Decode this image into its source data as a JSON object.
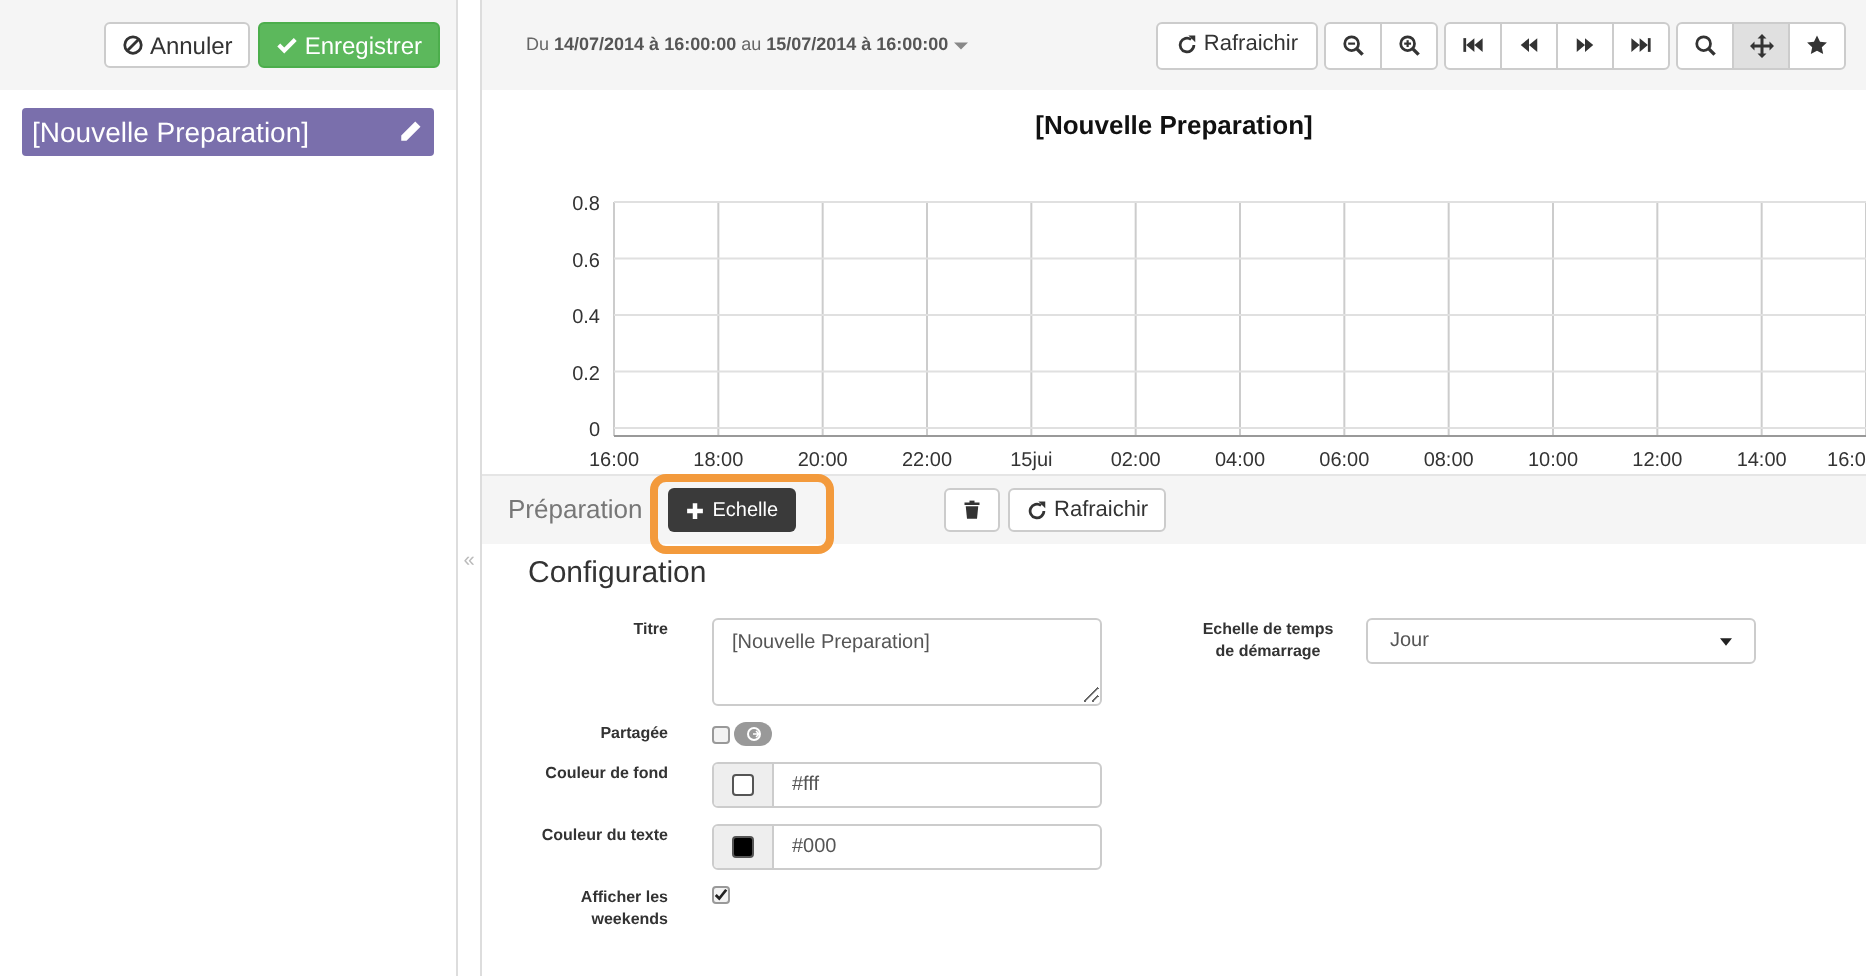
{
  "left_toolbar": {
    "buttons": [
      {
        "kind": "cancel",
        "label": "Annuler"
      },
      {
        "kind": "save",
        "label": "Enregistrer"
      }
    ]
  },
  "sidebar": {
    "items": [
      {
        "label": "[Nouvelle Preparation]",
        "selected": true
      }
    ]
  },
  "date_range": {
    "prefix": "Du",
    "start": "14/07/2014 à 16:00:00",
    "middle": "au",
    "end": "15/07/2014 à 16:00:00"
  },
  "toolbar": {
    "groups": [
      [
        {
          "kind": "refresh",
          "label": "Rafraichir",
          "active": false
        }
      ],
      [
        {
          "kind": "zoom-out",
          "active": false
        },
        {
          "kind": "zoom-in",
          "active": false
        }
      ],
      [
        {
          "kind": "first",
          "active": false
        },
        {
          "kind": "prev",
          "active": false
        },
        {
          "kind": "next",
          "active": false
        },
        {
          "kind": "last",
          "active": false
        }
      ],
      [
        {
          "kind": "search",
          "active": false
        },
        {
          "kind": "move",
          "active": true
        },
        {
          "kind": "star",
          "active": false
        }
      ]
    ]
  },
  "chart": {
    "chart_data": {
      "type": "line",
      "title": "[Nouvelle Preparation]",
      "categories": [
        "16:00",
        "18:00",
        "20:00",
        "22:00",
        "15jui",
        "02:00",
        "04:00",
        "06:00",
        "08:00",
        "10:00",
        "12:00",
        "14:00",
        "16:0"
      ],
      "ylim": [
        0,
        0.8
      ],
      "yticks": [
        0,
        0.2,
        0.4,
        0.6,
        0.8
      ],
      "grid": true
    }
  },
  "preparation_bar": {
    "label": "Préparation",
    "add_button": "Echelle",
    "refresh_button": "Rafraichir"
  },
  "collapse_handle": "«",
  "configuration": {
    "heading": "Configuration",
    "title_field": {
      "label": "Titre",
      "value": "[Nouvelle Preparation]"
    },
    "start_scale": {
      "label": "Echelle de temps de démarrage",
      "value": "Jour"
    },
    "shared": {
      "label": "Partagée",
      "checked": false,
      "share_button_disabled": true
    },
    "background_color": {
      "label": "Couleur de fond",
      "value": "#fff",
      "color": "#ffffff"
    },
    "text_color": {
      "label": "Couleur du texte",
      "value": "#000",
      "color": "#000000"
    },
    "show_weekends": {
      "label": "Afficher les weekends",
      "checked": true
    }
  }
}
